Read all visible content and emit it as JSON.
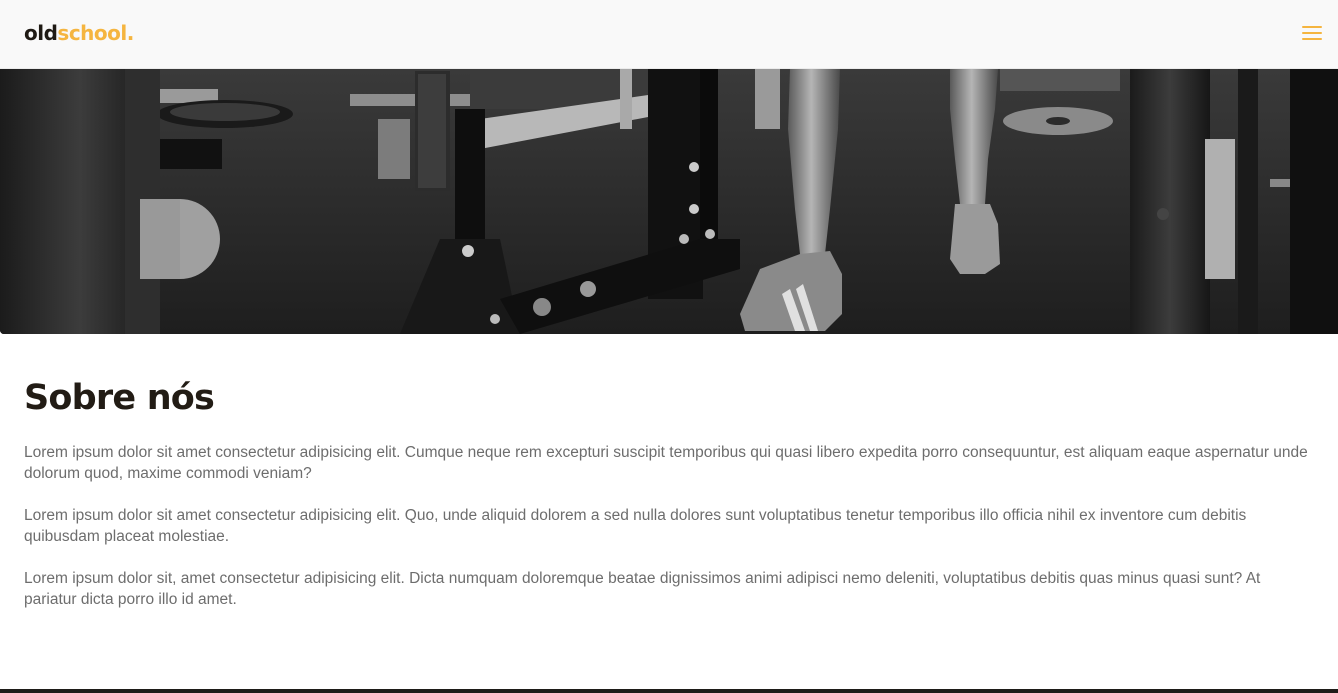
{
  "navbar": {
    "logo_part1": "old",
    "logo_part2": "school.",
    "menu_icon": "hamburger-menu-icon",
    "accent_color": "#f5b53f"
  },
  "hero": {
    "image": "gym-squat-rack-lifter-grayscale"
  },
  "about": {
    "title": "Sobre nós",
    "paragraphs": [
      "Lorem ipsum dolor sit amet consectetur adipisicing elit. Cumque neque rem excepturi suscipit temporibus qui quasi libero expedita porro consequuntur, est aliquam eaque aspernatur unde dolorum quod, maxime commodi veniam?",
      "Lorem ipsum dolor sit amet consectetur adipisicing elit. Quo, unde aliquid dolorem a sed nulla dolores sunt voluptatibus tenetur temporibus illo officia nihil ex inventore cum debitis quibusdam placeat molestiae.",
      "Lorem ipsum dolor sit, amet consectetur adipisicing elit. Dicta numquam doloremque beatae dignissimos animi adipisci nemo deleniti, voluptatibus debitis quas minus quasi sunt? At pariatur dicta porro illo id amet."
    ]
  }
}
